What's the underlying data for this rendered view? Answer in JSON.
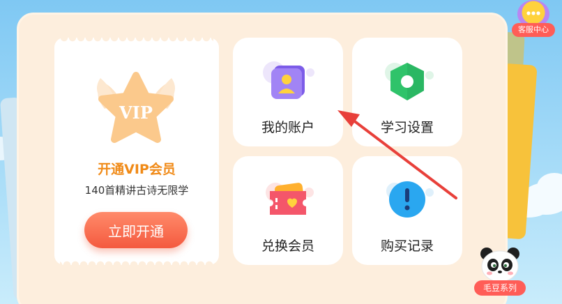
{
  "vip": {
    "badge_text": "VIP",
    "title": "开通VIP会员",
    "subtitle": "140首精讲古诗无限学",
    "button_label": "立即开通"
  },
  "tiles": [
    {
      "label": "我的账户",
      "icon": "account-icon"
    },
    {
      "label": "学习设置",
      "icon": "settings-hex-icon"
    },
    {
      "label": "兑换会员",
      "icon": "ticket-heart-icon"
    },
    {
      "label": "购买记录",
      "icon": "exclamation-icon"
    }
  ],
  "service": {
    "label": "客服中心",
    "icon": "chat-bubble-icon"
  },
  "series": {
    "label": "毛豆系列",
    "icon": "panda-icon"
  },
  "colors": {
    "accent_orange": "#f08a17",
    "button_red": "#f45a3f",
    "panel_bg": "#fdeedd",
    "tag_red": "#ff5d57"
  }
}
